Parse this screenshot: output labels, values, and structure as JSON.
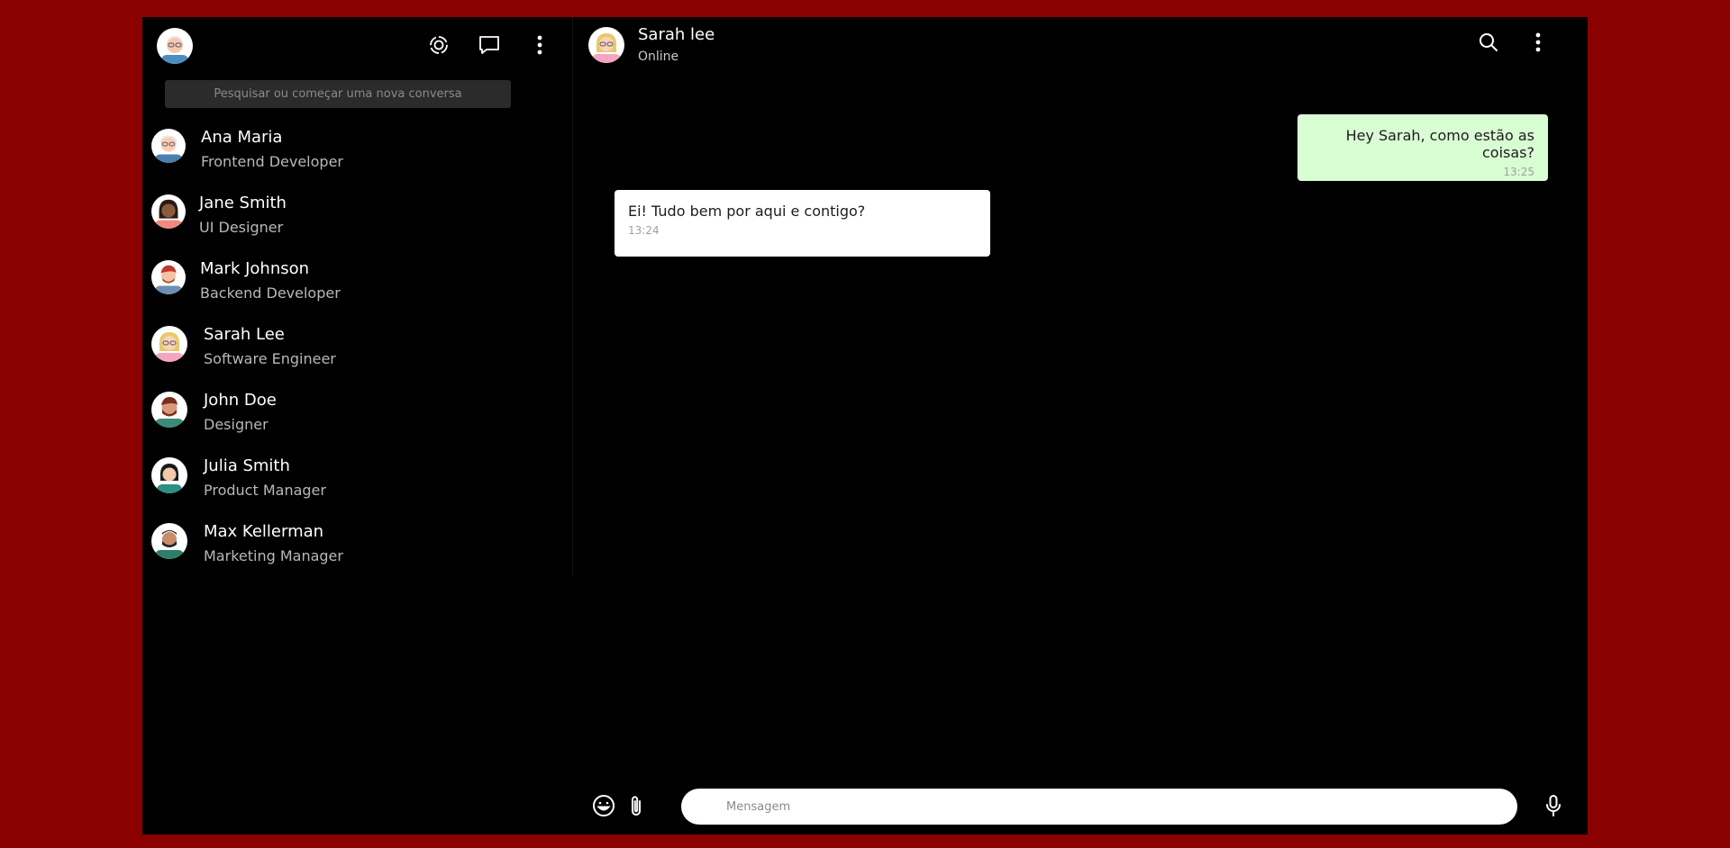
{
  "sidebar": {
    "search_placeholder": "Pesquisar ou começar uma nova conversa",
    "icons": [
      "status-icon",
      "new-chat-icon",
      "menu-icon"
    ],
    "contacts": [
      {
        "name": "Ana Maria",
        "role": "Frontend Developer"
      },
      {
        "name": "Jane Smith",
        "role": "UI Designer"
      },
      {
        "name": "Mark Johnson",
        "role": "Backend Developer"
      },
      {
        "name": "Sarah Lee",
        "role": "Software Engineer"
      },
      {
        "name": "John Doe",
        "role": "Designer"
      },
      {
        "name": "Julia Smith",
        "role": "Product Manager"
      },
      {
        "name": "Max Kellerman",
        "role": "Marketing Manager"
      }
    ]
  },
  "chat": {
    "contact_name": "Sarah lee",
    "contact_status": "Online",
    "messages": [
      {
        "direction": "out",
        "text": "Hey Sarah, como estão as coisas?",
        "time": "13:25"
      },
      {
        "direction": "in",
        "text": "Ei! Tudo bem por aqui e contigo?",
        "time": "13:24"
      }
    ],
    "composer_placeholder": "Mensagem"
  },
  "colors": {
    "page_background": "#8b0000",
    "app_background": "#000000",
    "outgoing_bubble": "#d9fdd3",
    "incoming_bubble": "#ffffff",
    "search_background": "#2b2b2b"
  }
}
